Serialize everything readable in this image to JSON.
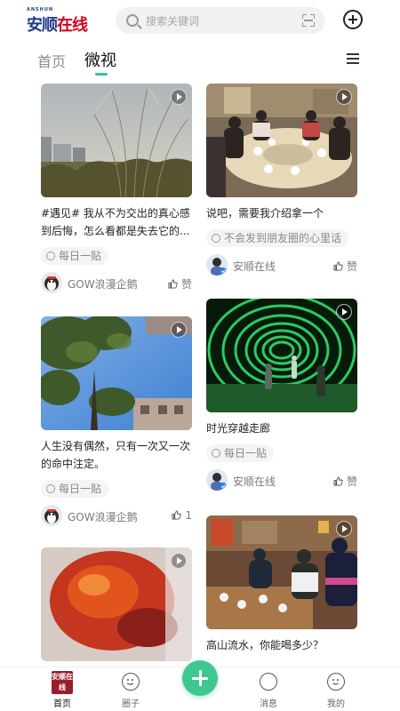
{
  "header": {
    "logo_text_part1": "安顺",
    "logo_text_part2": "在线",
    "logo_subtext": "ANSHUN",
    "search_placeholder": "搜索关键词"
  },
  "tabs": [
    {
      "label": "首页",
      "active": false
    },
    {
      "label": "微视",
      "active": true
    }
  ],
  "feed": [
    {
      "title": "#遇见# 我从不为交出的真心感到后悔，怎么看都是失去它的...",
      "tag": "每日一贴",
      "author": "GOW浪漫企鹅",
      "likes": "赞"
    },
    {
      "title": "说吧，需要我介绍拿一个",
      "tag": "不会发到朋友圈的心里话",
      "author": "安顺在线",
      "likes": "赞"
    },
    {
      "title": "人生没有偶然，只有一次又一次的命中注定。",
      "tag": "每日一贴",
      "author": "GOW浪漫企鹅",
      "likes": "1"
    },
    {
      "title": "时光穿越走廊",
      "tag": "每日一贴",
      "author": "安顺在线",
      "likes": "赞"
    },
    {
      "title": "",
      "tag": "",
      "author": "",
      "likes": ""
    },
    {
      "title": "高山流水，你能喝多少？",
      "tag": "",
      "author": "",
      "likes": ""
    }
  ],
  "bottom_nav": [
    {
      "label": "首页",
      "icon": "home-logo-icon",
      "active": true
    },
    {
      "label": "圈子",
      "icon": "circle-icon",
      "active": false
    },
    {
      "label": "",
      "icon": "add-post-icon",
      "active": false
    },
    {
      "label": "消息",
      "icon": "message-icon",
      "active": false
    },
    {
      "label": "我的",
      "icon": "profile-icon",
      "active": false
    }
  ],
  "nav_home_icon_text": "安顺在线",
  "colors": {
    "accent": "#36c0a7",
    "add_button": "#3ec88f",
    "logo_blue": "#1f3a8a",
    "logo_red": "#d0021b"
  }
}
